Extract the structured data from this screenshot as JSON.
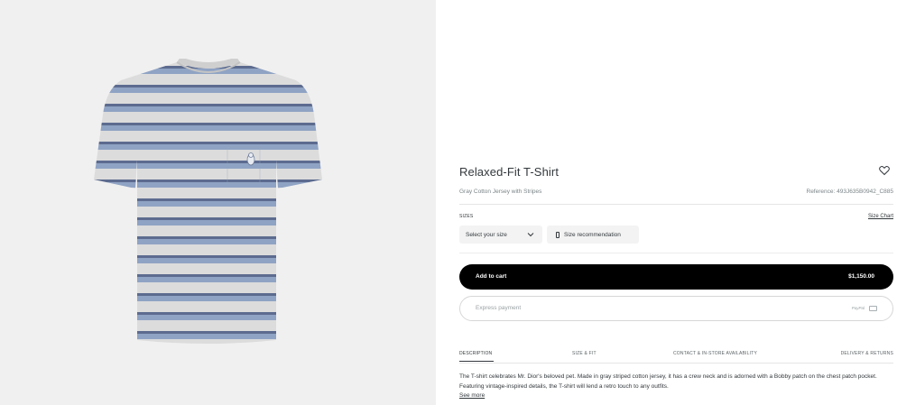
{
  "product": {
    "title": "Relaxed-Fit T-Shirt",
    "subtitle": "Gray Cotton Jersey with Stripes",
    "reference": "Reference: 493J635B0942_C885",
    "image_alt": "Striped t-shirt product image"
  },
  "sizes": {
    "label": "SIZES",
    "size_chart_link": "Size Chart",
    "select_placeholder": "Select your size",
    "recommendation_label": "Size recommendation"
  },
  "purchase": {
    "add_to_cart_label": "Add to cart",
    "price": "$1,150.00",
    "express_payment_label": "Express payment",
    "paypal_label": "PayPal"
  },
  "tabs": [
    {
      "label": "DESCRIPTION",
      "active": true
    },
    {
      "label": "SIZE & FIT",
      "active": false
    },
    {
      "label": "CONTACT & IN-STORE AVAILABILITY",
      "active": false
    },
    {
      "label": "DELIVERY & RETURNS",
      "active": false
    }
  ],
  "description": {
    "text": "The T-shirt celebrates Mr. Dior's beloved pet. Made in gray striped cotton jersey, it has a crew neck and is adorned with a Bobby patch on the chest patch pocket. Featuring vintage-inspired details, the T-shirt will lend a retro touch to any outfits.",
    "see_more": "See more"
  },
  "colors": {
    "stripe_blue": "#8fa3c4",
    "stripe_navy": "#5c6b8f",
    "heather_gray": "#dcdcdc",
    "button_black": "#000000"
  },
  "icons": {
    "wishlist": "heart-icon",
    "dropdown": "chevron-down-icon",
    "size_reco": "ruler-icon",
    "card": "credit-card-icon"
  }
}
